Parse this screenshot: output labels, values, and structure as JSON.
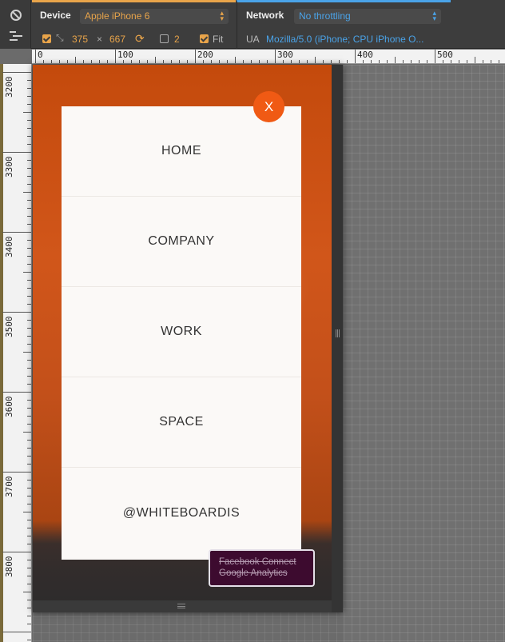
{
  "toolbar": {
    "device": {
      "section_label": "Device",
      "selected_device": "Apple iPhone 6",
      "width": "375",
      "times": "×",
      "height": "667",
      "dpr": "2",
      "fit_label": "Fit"
    },
    "network": {
      "section_label": "Network",
      "throttling": "No throttling",
      "ua_label": "UA",
      "ua_value": "Mozilla/5.0 (iPhone; CPU iPhone O..."
    },
    "icons": {
      "block": "block-icon",
      "panel": "panel-toggle-icon",
      "rotate": "rotate-icon",
      "resolution": "resolution-icon"
    },
    "accent_colors": {
      "device": "#e8a44a",
      "network": "#4aa3e8"
    }
  },
  "rulers": {
    "top_labels": [
      "0",
      "100",
      "200",
      "300",
      "400",
      "500"
    ],
    "left_labels": [
      "3200",
      "3300",
      "3400",
      "3500",
      "3600",
      "3700",
      "3800"
    ]
  },
  "page": {
    "close_label": "X",
    "menu_items": [
      "HOME",
      "COMPANY",
      "WORK",
      "SPACE",
      "@WHITEBOARDIS"
    ],
    "accent_color": "#f05a14"
  },
  "badge": {
    "lines": [
      "Facebook Connect",
      "Google Analytics"
    ]
  }
}
